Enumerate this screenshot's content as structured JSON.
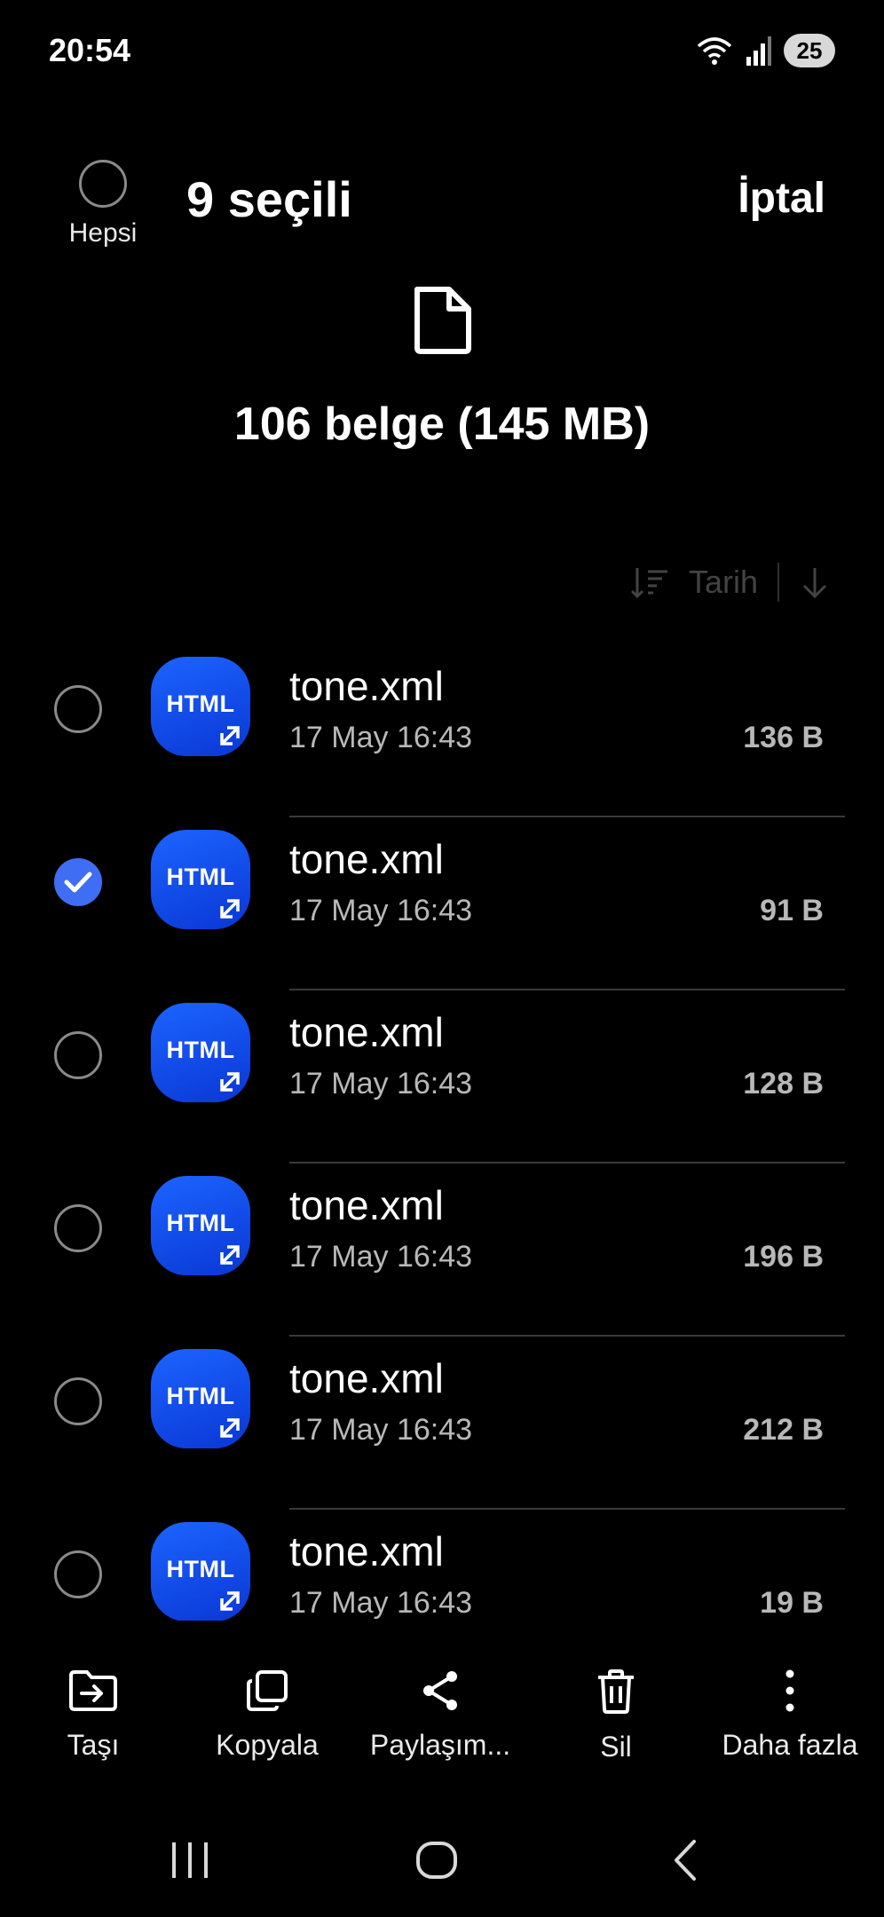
{
  "status_bar": {
    "time": "20:54",
    "battery": "25"
  },
  "header": {
    "select_all_label": "Hepsi",
    "selected_count": "9 seçili",
    "cancel_label": "İptal"
  },
  "summary": {
    "text": "106 belge (145 MB)"
  },
  "sort": {
    "label": "Tarih"
  },
  "files": [
    {
      "icon_label": "HTML",
      "name": "tone.xml",
      "date": "17 May 16:43",
      "size": "136 B",
      "checked": false
    },
    {
      "icon_label": "HTML",
      "name": "tone.xml",
      "date": "17 May 16:43",
      "size": "91 B",
      "checked": true
    },
    {
      "icon_label": "HTML",
      "name": "tone.xml",
      "date": "17 May 16:43",
      "size": "128 B",
      "checked": false
    },
    {
      "icon_label": "HTML",
      "name": "tone.xml",
      "date": "17 May 16:43",
      "size": "196 B",
      "checked": false
    },
    {
      "icon_label": "HTML",
      "name": "tone.xml",
      "date": "17 May 16:43",
      "size": "212 B",
      "checked": false
    },
    {
      "icon_label": "HTML",
      "name": "tone.xml",
      "date": "17 May 16:43",
      "size": "19 B",
      "checked": false
    }
  ],
  "actions": [
    {
      "label": "Taşı",
      "icon": "move-folder-icon"
    },
    {
      "label": "Kopyala",
      "icon": "copy-icon"
    },
    {
      "label": "Paylaşım...",
      "icon": "share-icon"
    },
    {
      "label": "Sil",
      "icon": "trash-icon"
    },
    {
      "label": "Daha fazla",
      "icon": "more-vertical-icon"
    }
  ],
  "colors": {
    "accent": "#3f6df3",
    "icon_blue": "#1c64ff",
    "background": "#000000"
  }
}
